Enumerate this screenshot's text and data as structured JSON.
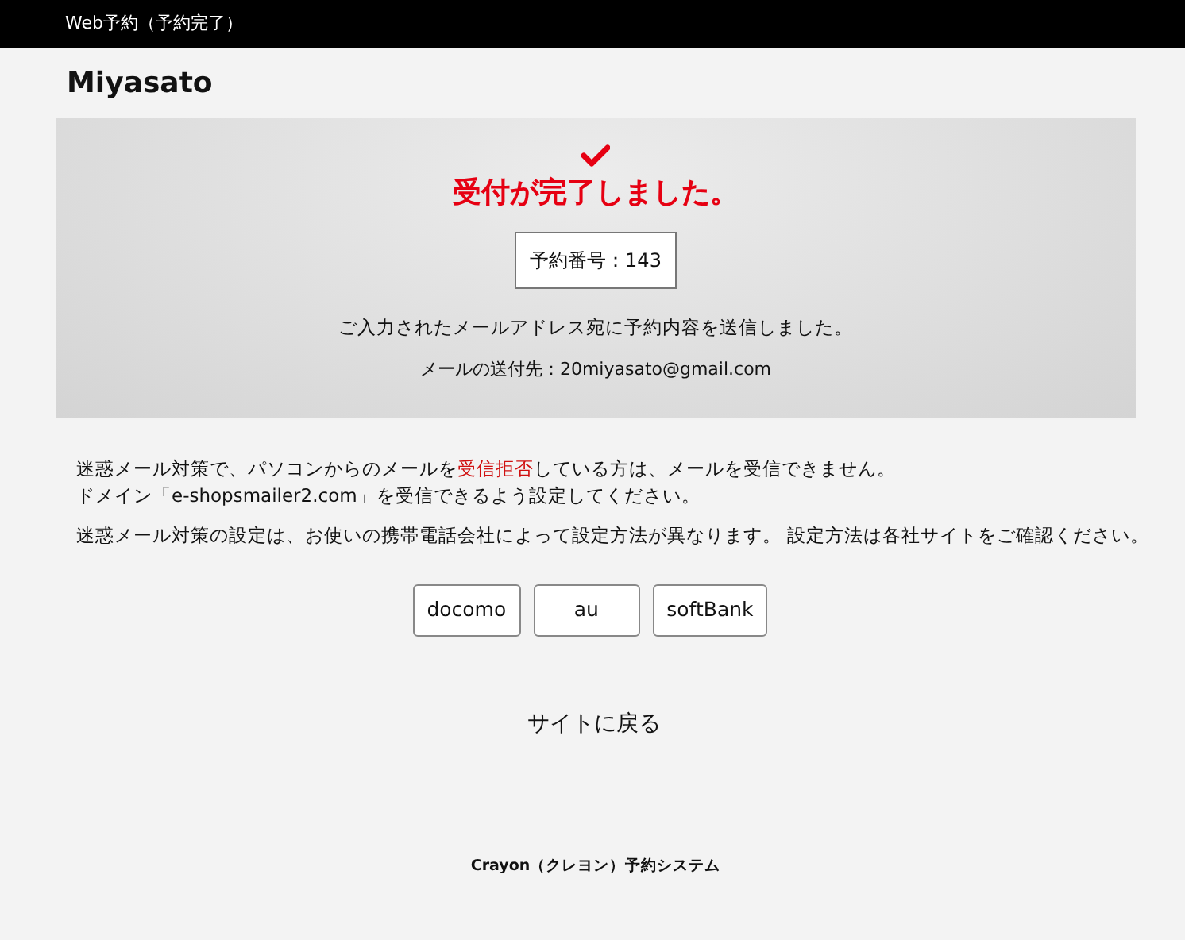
{
  "header": {
    "title": "Web予約（予約完了）"
  },
  "shop_name": "Miyasato",
  "result": {
    "heading": "受付が完了しました。",
    "reservation_number": "予約番号：143",
    "message": "ご入力されたメールアドレス宛に予約内容を送信しました。",
    "email": "メールの送付先：20miyasato@gmail.com"
  },
  "notice": {
    "lines": [
      [
        {
          "text": "迷惑メール対策で、パソコンからのメールを",
          "emphasis": false
        },
        {
          "text": "受信拒否",
          "emphasis": true
        },
        {
          "text": "している方は、メールを受信できません。",
          "emphasis": false
        }
      ],
      [
        {
          "text": "ドメイン「e-shopsmailer2.com」を受信できるよう設定してください。",
          "emphasis": false
        }
      ]
    ],
    "settings": "迷惑メール対策の設定は、お使いの携帯電話会社によって設定方法が異なります。 設定方法は各社サイトをご確認ください。"
  },
  "carrier_buttons": [
    "docomo",
    "au",
    "softBank"
  ],
  "back_link": "サイトに戻る",
  "footer": "Crayon（クレヨン）予約システム"
}
